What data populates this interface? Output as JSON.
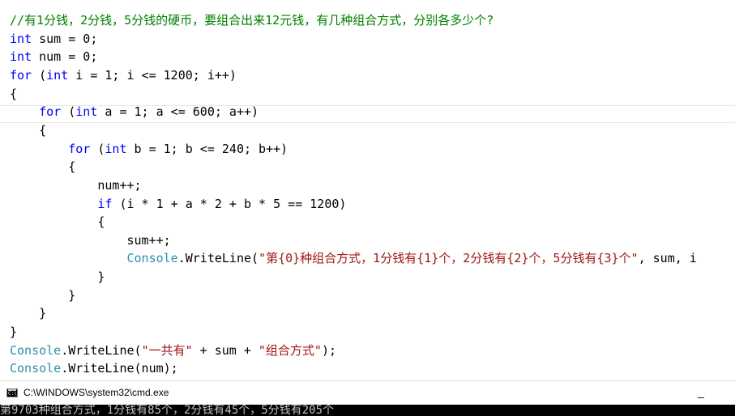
{
  "editor": {
    "lines": [
      {
        "tokens": [
          {
            "text": "//有1分钱，2分钱，5分钱的硬币，要组合出来12元钱，有几种组合方式，分别各多少个?",
            "kind": "comment"
          }
        ]
      },
      {
        "tokens": [
          {
            "text": "int",
            "kind": "keyword"
          },
          {
            "text": " sum = 0;",
            "kind": "text"
          }
        ]
      },
      {
        "tokens": [
          {
            "text": "int",
            "kind": "keyword"
          },
          {
            "text": " num = 0;",
            "kind": "text"
          }
        ]
      },
      {
        "tokens": [
          {
            "text": "for",
            "kind": "keyword"
          },
          {
            "text": " (",
            "kind": "text"
          },
          {
            "text": "int",
            "kind": "keyword"
          },
          {
            "text": " i = 1; i <= 1200; i++)",
            "kind": "text"
          }
        ]
      },
      {
        "tokens": [
          {
            "text": "{",
            "kind": "text"
          }
        ]
      },
      {
        "tokens": [
          {
            "text": "    ",
            "kind": "text"
          },
          {
            "text": "for",
            "kind": "keyword"
          },
          {
            "text": " (",
            "kind": "text"
          },
          {
            "text": "int",
            "kind": "keyword"
          },
          {
            "text": " a = 1; a <= 600; a++)",
            "kind": "text"
          }
        ]
      },
      {
        "tokens": [
          {
            "text": "    {",
            "kind": "text"
          }
        ]
      },
      {
        "tokens": [
          {
            "text": "        ",
            "kind": "text"
          },
          {
            "text": "for",
            "kind": "keyword"
          },
          {
            "text": " (",
            "kind": "text"
          },
          {
            "text": "int",
            "kind": "keyword"
          },
          {
            "text": " b = 1; b <= 240; b++)",
            "kind": "text"
          }
        ]
      },
      {
        "tokens": [
          {
            "text": "        {",
            "kind": "text"
          }
        ]
      },
      {
        "tokens": [
          {
            "text": "            num++;",
            "kind": "text"
          }
        ]
      },
      {
        "tokens": [
          {
            "text": "            ",
            "kind": "text"
          },
          {
            "text": "if",
            "kind": "keyword"
          },
          {
            "text": " (i * 1 + a * 2 + b * 5 == 1200)",
            "kind": "text"
          }
        ]
      },
      {
        "tokens": [
          {
            "text": "            {",
            "kind": "text"
          }
        ]
      },
      {
        "tokens": [
          {
            "text": "                sum++;",
            "kind": "text"
          }
        ]
      },
      {
        "tokens": [
          {
            "text": "                ",
            "kind": "text"
          },
          {
            "text": "Console",
            "kind": "type"
          },
          {
            "text": ".WriteLine(",
            "kind": "text"
          },
          {
            "text": "\"第{0}种组合方式，1分钱有{1}个，2分钱有{2}个，5分钱有{3}个\"",
            "kind": "string"
          },
          {
            "text": ", sum, i",
            "kind": "text"
          }
        ]
      },
      {
        "tokens": [
          {
            "text": "            }",
            "kind": "text"
          }
        ]
      },
      {
        "tokens": [
          {
            "text": "        }",
            "kind": "text"
          }
        ]
      },
      {
        "tokens": [
          {
            "text": "    }",
            "kind": "text"
          }
        ]
      },
      {
        "tokens": [
          {
            "text": "}",
            "kind": "text"
          }
        ]
      },
      {
        "tokens": [
          {
            "text": "Console",
            "kind": "type"
          },
          {
            "text": ".WriteLine(",
            "kind": "text"
          },
          {
            "text": "\"一共有\"",
            "kind": "string"
          },
          {
            "text": " + sum + ",
            "kind": "text"
          },
          {
            "text": "\"组合方式\"",
            "kind": "string"
          },
          {
            "text": ");",
            "kind": "text"
          }
        ]
      },
      {
        "tokens": [
          {
            "text": "Console",
            "kind": "type"
          },
          {
            "text": ".WriteLine(num);",
            "kind": "text"
          }
        ]
      }
    ]
  },
  "syntax_colors": {
    "keyword": "#0000ff",
    "comment": "#008000",
    "type": "#2b91af",
    "string": "#a31515",
    "text": "#000000"
  },
  "cmd_window": {
    "title": "C:\\WINDOWS\\system32\\cmd.exe",
    "icon": "console-app-icon",
    "minimize_label": "_",
    "output_line": "第9703种组合方式，1分钱有85个，2分钱有45个，5分钱有205个",
    "background_color": "#000000",
    "text_color": "#c0c0c0"
  }
}
